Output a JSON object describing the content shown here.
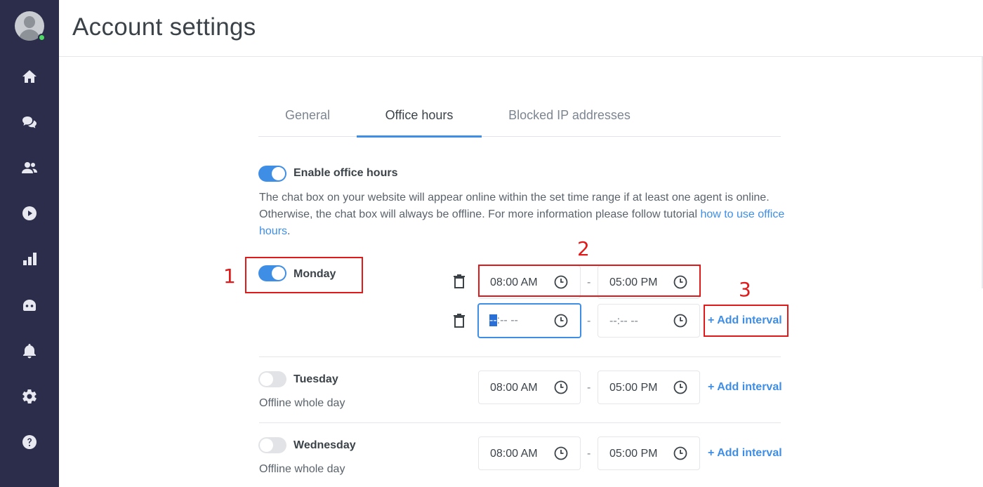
{
  "sidebar": {
    "avatar_status_color": "#4cd964",
    "items": [
      {
        "name": "home-icon"
      },
      {
        "name": "chats-icon"
      },
      {
        "name": "contacts-icon"
      },
      {
        "name": "play-icon"
      },
      {
        "name": "reports-icon"
      },
      {
        "name": "bot-icon"
      },
      {
        "name": "notifications-icon"
      },
      {
        "name": "settings-icon"
      },
      {
        "name": "help-icon"
      }
    ]
  },
  "header": {
    "title": "Account settings"
  },
  "tabs": [
    {
      "label": "General",
      "active": false
    },
    {
      "label": "Office hours",
      "active": true
    },
    {
      "label": "Blocked IP addresses",
      "active": false
    }
  ],
  "enable": {
    "label": "Enable office hours",
    "on": true,
    "description": "The chat box on your website will appear online within the set time range if at least one agent is online. Otherwise, the chat box will always be offline. For more information please follow tutorial ",
    "link_text": "how to use office hours",
    "description_end": "."
  },
  "days": {
    "monday": {
      "label": "Monday",
      "on": true,
      "intervals": [
        {
          "from": "08:00 AM",
          "to": "05:00 PM"
        },
        {
          "from_selected": "--",
          "from_rest": ":-- --",
          "to": "--:-- --"
        }
      ],
      "add_label": "+ Add interval"
    },
    "tuesday": {
      "label": "Tuesday",
      "on": false,
      "status": "Offline whole day",
      "from": "08:00 AM",
      "to": "05:00 PM",
      "add_label": "+ Add interval"
    },
    "wednesday": {
      "label": "Wednesday",
      "on": false,
      "status": "Offline whole day",
      "from": "08:00 AM",
      "to": "05:00 PM",
      "add_label": "+ Add interval"
    }
  },
  "separator": "-",
  "annotations": [
    "1",
    "2",
    "3"
  ],
  "colors": {
    "accent": "#3f8ee6",
    "sidebar": "#2c2d4a",
    "annotation": "#e01a1a"
  }
}
